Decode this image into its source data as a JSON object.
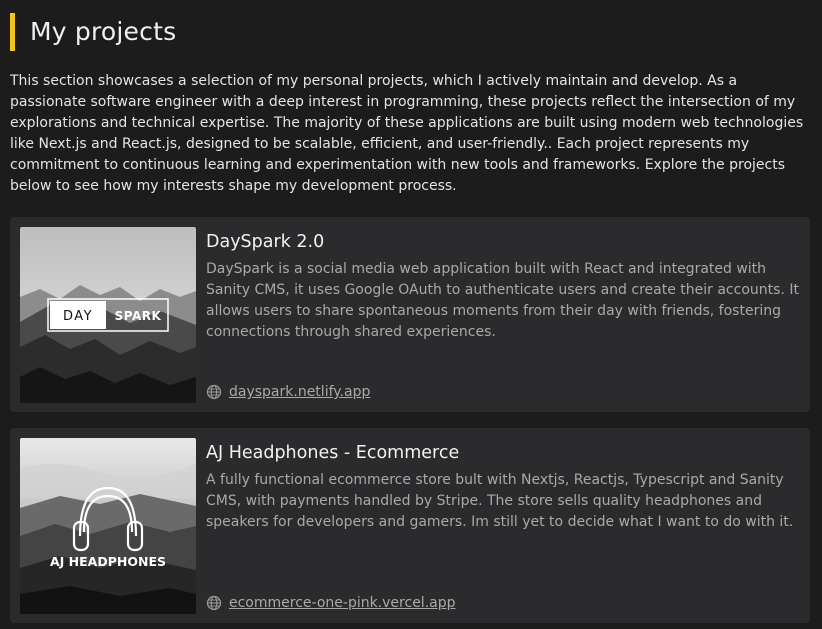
{
  "page": {
    "title": "My projects",
    "intro": "This section showcases a selection of my personal projects, which I actively maintain and develop. As a passionate software engineer with a deep interest in programming, these projects reflect the intersection of my explorations and technical expertise. The majority of these applications are built using modern web technologies like Next.js and React.js, designed to be scalable, efficient, and user-friendly.. Each project represents my commitment to continuous learning and experimentation with new tools and frameworks. Explore the projects below to see how my interests shape my development process.",
    "accent_color": "#f5c518"
  },
  "projects": [
    {
      "title": "DaySpark 2.0",
      "description": "DaySpark is a social media web application built with React and integrated with Sanity CMS, it uses Google OAuth to authenticate users and create their accounts. It allows users to share spontaneous moments from their day with friends, fostering connections through shared experiences.",
      "link": "dayspark.netlify.app",
      "link_icon": "globe-icon",
      "logo_text_left": "DAY",
      "logo_text_right": "SPARK"
    },
    {
      "title": "AJ Headphones - Ecommerce",
      "description": "A fully functional ecommerce store bult with Nextjs, Reactjs, Typescript and Sanity CMS, with payments handled by Stripe. The store sells quality headphones and speakers for developers and gamers. Im still yet to decide what I want to do with it.",
      "link": "ecommerce-one-pink.vercel.app",
      "link_icon": "globe-icon",
      "logo_text": "AJ HEADPHONES"
    }
  ]
}
